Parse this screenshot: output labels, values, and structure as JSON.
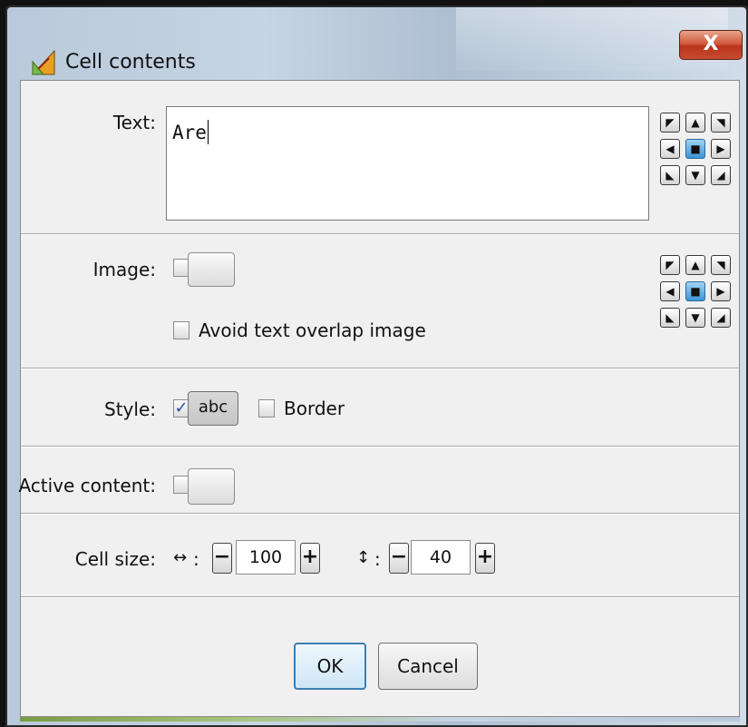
{
  "window": {
    "title": "Cell contents",
    "close_label": "X"
  },
  "text_row": {
    "label": "Text:",
    "value": "Are"
  },
  "alignment_glyphs": [
    "◤",
    "▲",
    "◥",
    "◀",
    "■",
    "▶",
    "◣",
    "▼",
    "◢"
  ],
  "image_row": {
    "label": "Image:",
    "avoid_overlap_label": "Avoid text overlap image",
    "avoid_overlap_checked": false
  },
  "style_row": {
    "label": "Style:",
    "style_checked": true,
    "style_button_label": "abc",
    "border_label": "Border",
    "border_checked": false
  },
  "active_content_row": {
    "label": "Active content:"
  },
  "cell_size_row": {
    "label": "Cell size:",
    "width_icon": "↔",
    "height_icon": "↕",
    "separator": ":",
    "minus_label": "−",
    "plus_label": "+",
    "width_value": "100",
    "height_value": "40"
  },
  "buttons": {
    "ok_label": "OK",
    "cancel_label": "Cancel"
  },
  "colors": {
    "close_button": "#c74b2f",
    "center_align": "#3d95d6",
    "default_button_border": "#3c7fb1"
  }
}
